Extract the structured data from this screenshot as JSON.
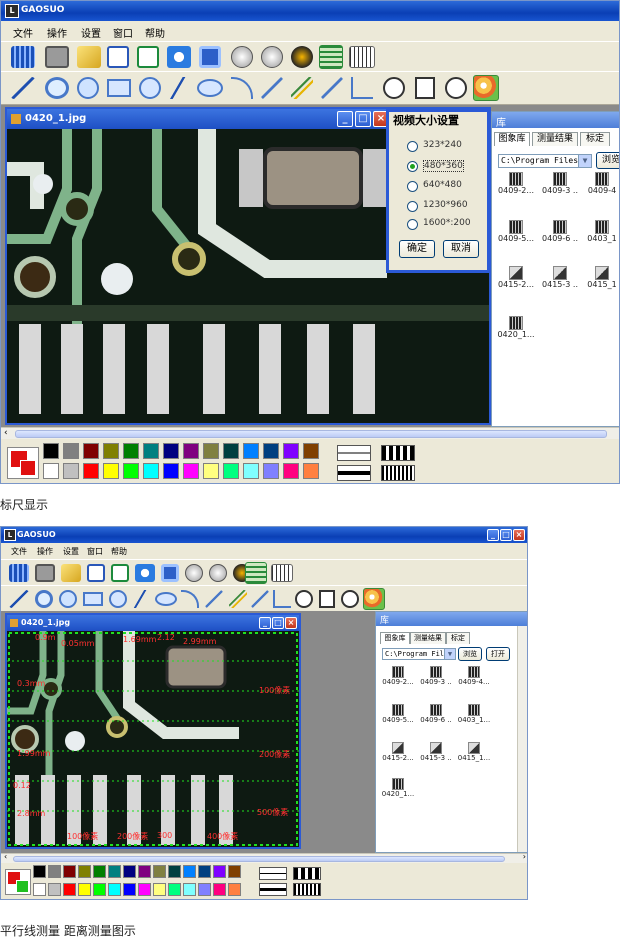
{
  "screen1": {
    "app_title": "GAOSUO",
    "menu": [
      "文件",
      "操作",
      "设置",
      "窗口",
      "帮助"
    ],
    "child_title": "0420_1.jpg",
    "dialog": {
      "title": "视频大小设置",
      "options": [
        "323*240",
        "480*360",
        "640*480",
        "1230*960",
        "1600*:200"
      ],
      "selected_index": 1,
      "ok_label": "确定",
      "cancel_label": "取消"
    },
    "library": {
      "title": "库",
      "tabs": [
        "图象库",
        "测量结果",
        "标定"
      ],
      "path": "C:\\Program Files",
      "browse_label": "浏览",
      "thumbs": [
        "0409-2...",
        "0409-3 ..",
        "0409-4",
        "0409-5...",
        "0409-6 ..",
        "0403_1",
        "0415-2...",
        "0415-3 ..",
        "0415_1",
        "0420_1..."
      ]
    }
  },
  "caption1": "标尺显示",
  "screen2": {
    "app_title": "GAOSUO",
    "menu": [
      "文件",
      "操作",
      "设置",
      "窗口",
      "帮助"
    ],
    "child_title": "0420_1.jpg",
    "library": {
      "title": "库",
      "tabs": [
        "图象库",
        "测量结果",
        "标定"
      ],
      "path": "C:\\Program Files",
      "browse_label": "浏览",
      "open_label": "打开",
      "thumbs": [
        "0409-2...",
        "0409-3 ..",
        "0409-4...",
        "0409-5...",
        "0409-6 ..",
        "0403_1...",
        "0415-2...",
        "0415-3 ..",
        "0415_1...",
        "0420_1..."
      ]
    },
    "measure_labels": [
      "0.9m",
      "0.05mm",
      "1.69mm",
      "2.12",
      "2.99mm",
      "0.3mm",
      "100像素",
      "1.99mm",
      "200像素",
      "0.12",
      "2.8mm",
      "100像素",
      "200像素",
      "300",
      "400像素",
      "500像素"
    ]
  },
  "caption2": "平行线测量 距离测量图示",
  "palette_colors": {
    "top": [
      "#000000",
      "#808080",
      "#800000",
      "#808000",
      "#008000",
      "#008080",
      "#000080",
      "#800080",
      "#808040",
      "#004040",
      "#0080ff",
      "#004080",
      "#8000ff",
      "#804000"
    ],
    "bottom": [
      "#ffffff",
      "#c0c0c0",
      "#ff0000",
      "#ffff00",
      "#00ff00",
      "#00ffff",
      "#0000ff",
      "#ff00ff",
      "#ffff80",
      "#00ff80",
      "#80ffff",
      "#8080ff",
      "#ff0080",
      "#ff8040"
    ]
  },
  "toolbar_icons_row1": [
    "film-icon",
    "camera-icon",
    "open-folder-icon",
    "word-export-icon",
    "excel-export-icon",
    "refresh-icon",
    "save-icon",
    "pause-icon",
    "stop-icon",
    "wrench-icon",
    "ruler-vertical-icon",
    "ruler-horizontal-icon"
  ],
  "toolbar_icons_row2": [
    "line-tool-icon",
    "magnifier-icon",
    "circle-select-icon",
    "rectangle-tool-icon",
    "circle-tool-icon",
    "polyline-tool-icon",
    "ellipse-tool-icon",
    "arc-tool-icon",
    "point-tool-icon",
    "parallel-tool-icon",
    "distance-tool-icon",
    "angle-tool-icon",
    "vertical-line-tool-icon",
    "text-tool-icon",
    "diamond-tool-icon",
    "palette-icon"
  ]
}
